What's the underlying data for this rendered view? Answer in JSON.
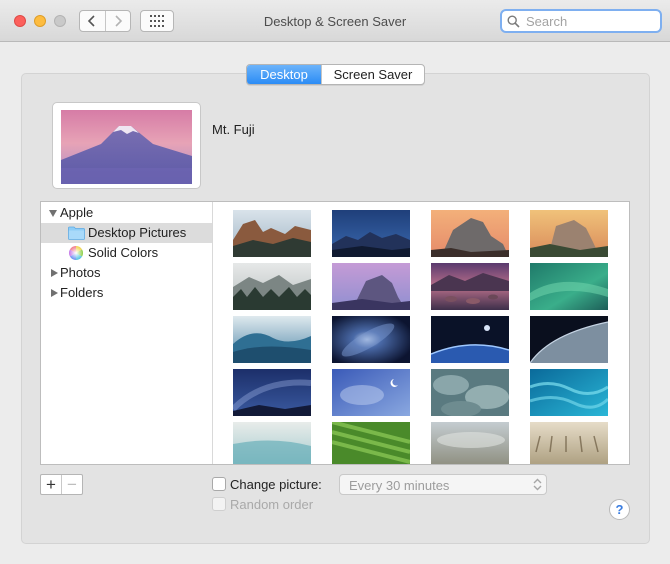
{
  "window": {
    "title": "Desktop & Screen Saver",
    "search_placeholder": "Search"
  },
  "tabs": [
    {
      "label": "Desktop",
      "selected": true
    },
    {
      "label": "Screen Saver",
      "selected": false
    }
  ],
  "preview": {
    "wallpaper_name": "Mt. Fuji"
  },
  "sidebar": {
    "items": [
      {
        "label": "Apple",
        "expanded": true
      },
      {
        "label": "Desktop Pictures",
        "selected": true
      },
      {
        "label": "Solid Colors"
      },
      {
        "label": "Photos",
        "expanded": false
      },
      {
        "label": "Folders",
        "expanded": false
      }
    ]
  },
  "thumbnails": [
    "yosemite-dusk",
    "blue-mountains",
    "half-dome-sunset",
    "el-capitan-sunset",
    "foggy-forest",
    "half-dome-purple",
    "lake-rocks-dusk",
    "green-wave",
    "ocean-wave",
    "galaxy",
    "earth-horizon",
    "earth-from-space",
    "milky-way",
    "cloudy-night",
    "storm-clouds",
    "turquoise-water",
    "beach-shore",
    "green-fields",
    "desert-haze",
    "misty-fields"
  ],
  "controls": {
    "add_label": "+",
    "remove_label": "−",
    "change_picture_label": "Change picture:",
    "change_picture_checked": false,
    "interval_value": "Every 30 minutes",
    "random_order_label": "Random order",
    "random_order_enabled": false,
    "help_label": "?"
  },
  "colors": {
    "accent": "#2b8cf5",
    "close": "#fc605c",
    "minimize": "#fdbc40",
    "zoom_inactive": "#c9c9c9",
    "search_focus": "#7eaff0"
  }
}
